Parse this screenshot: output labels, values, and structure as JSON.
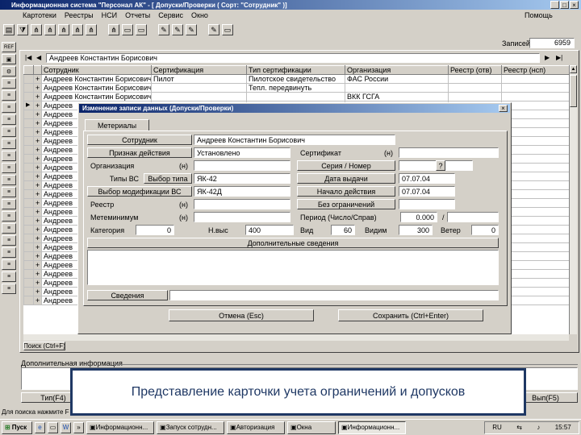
{
  "window": {
    "title": "Информационная система \"Персонал АК\" - [ Допуски/Проверки ( Сорт: \"Сотрудник\" )]"
  },
  "menubar": {
    "items": [
      "Картотеки",
      "Реестры",
      "НСИ",
      "Отчеты",
      "Сервис",
      "Окно"
    ],
    "right": "Помощь"
  },
  "records": {
    "label": "Записей",
    "count": "6959"
  },
  "filter": {
    "value": "Андреев Константин Борисович"
  },
  "table": {
    "columns": [
      "Сотрудник",
      "Сертификация",
      "Тип сертификации",
      "Организация",
      "Реестр (отв)",
      "Реестр (нсп)"
    ],
    "rows": [
      [
        "+",
        "Андреев Константин Борисович",
        "Пилот",
        "Пилотское свидетельство",
        "ФАС России",
        ""
      ],
      [
        "+",
        "Андреев Константин Борисович",
        "",
        "Тепл. передвинуть",
        "",
        ""
      ],
      [
        "+",
        "Андреев Константин Борисович",
        "",
        "",
        "ВКК ГСГА",
        ""
      ],
      [
        "▶",
        "Андреев",
        "",
        "",
        "",
        ""
      ],
      [
        "+",
        "Андреев",
        "",
        "",
        "",
        ""
      ],
      [
        "+",
        "Андреев",
        "",
        "",
        "",
        ""
      ],
      [
        "+",
        "Андреев",
        "",
        "",
        "",
        ""
      ],
      [
        "+",
        "Андреев",
        "",
        "",
        "",
        ""
      ],
      [
        "+",
        "Андреев",
        "",
        "",
        "",
        ""
      ],
      [
        "+",
        "Андреев",
        "",
        "",
        "",
        ""
      ],
      [
        "+",
        "Андреев",
        "",
        "",
        "",
        ""
      ],
      [
        "+",
        "Андреев",
        "",
        "",
        "",
        ""
      ],
      [
        "+",
        "Андреев",
        "",
        "",
        "",
        ""
      ],
      [
        "+",
        "Андреев",
        "",
        "",
        "",
        ""
      ],
      [
        "+",
        "Андреев",
        "",
        "",
        "",
        ""
      ],
      [
        "+",
        "Андреев",
        "",
        "",
        "",
        ""
      ],
      [
        "+",
        "Андреев",
        "",
        "",
        "",
        ""
      ],
      [
        "+",
        "Андреев",
        "",
        "",
        "",
        ""
      ],
      [
        "+",
        "Андреев",
        "",
        "",
        "",
        ""
      ],
      [
        "+",
        "Андреев",
        "",
        "",
        "",
        ""
      ],
      [
        "+",
        "Андреев",
        "",
        "",
        "",
        ""
      ],
      [
        "+",
        "Андреев",
        "",
        "",
        "",
        ""
      ],
      [
        "+",
        "Андреев",
        "",
        "",
        "",
        ""
      ],
      [
        "+",
        "Андреев",
        "",
        "",
        "",
        ""
      ],
      [
        "+",
        "Андреев",
        "",
        "",
        "",
        ""
      ],
      [
        "+",
        "Андреев",
        "",
        "",
        "",
        ""
      ]
    ]
  },
  "search_label": "Поиск (Ctrl+F)",
  "info_label": "Дополнительная информация",
  "bottom_left_button": "Тип(F4)",
  "bottom_right_button": "Вып(F5)",
  "hint_text": "Для поиска нажмите F",
  "dialog": {
    "title": "Изменение записи данных  (Допуски/Проверки)",
    "tab": "Метериалы",
    "employee": {
      "label": "Сотрудник",
      "value": "Андреев Константин Борисович"
    },
    "action": {
      "label": "Признак действия",
      "value": "Установлено"
    },
    "certificate": {
      "label": "Сертификат",
      "suffix": "(н)"
    },
    "organization": {
      "label": "Организация",
      "suffix": "(н)"
    },
    "series": {
      "label": "Серия / Номер",
      "button": "?"
    },
    "bs_type": {
      "label": "Типы ВС",
      "button": "Выбор типа",
      "value": "ЯК-42"
    },
    "issue_date": {
      "label": "Дата выдачи",
      "value": "07.07.04"
    },
    "bs_mod": {
      "label": "Выбор модификации ВС",
      "value": "ЯК-42Д"
    },
    "check_start": {
      "label": "Начало действия",
      "value": "07.07.04"
    },
    "registry": {
      "label": "Реестр",
      "suffix": "(н)"
    },
    "valid_until": {
      "label": "Без ограничений"
    },
    "materials": {
      "label": "Метеминимум",
      "suffix": "(н)"
    },
    "period": {
      "label": "Период (Число/Справ)",
      "value": "0.000",
      "extra": "/"
    },
    "category": {
      "label": "Категория",
      "value": "0"
    },
    "height": {
      "label": "Н.выс",
      "value": "400"
    },
    "vid": {
      "label": "Вид",
      "value": "60"
    },
    "vidim": {
      "label": "Видим",
      "value": "300"
    },
    "vetr": {
      "label": "Ветер",
      "value": "0"
    },
    "extra_header": "Дополнительные сведения",
    "note_label": "Сведения",
    "cancel_button": "Отмена (Esc)",
    "save_button": "Сохранить (Ctrl+Enter)"
  },
  "caption": {
    "text": "Представление карточки учета ограничений и допусков"
  },
  "taskbar": {
    "start": "Пуск",
    "tasks": [
      "Информационн...",
      "Запуск сотрудн...",
      "Авторизация",
      "Окна",
      "Информационн..."
    ],
    "lang": "RU",
    "time": "15:57"
  },
  "side_icons": [
    "ref-icon",
    "ref-icon",
    "tool-icon",
    "doc-icon",
    "doc-icon",
    "doc-icon",
    "doc-icon",
    "doc-icon",
    "doc-icon",
    "doc-icon",
    "doc-icon",
    "doc-icon",
    "doc-icon",
    "doc-icon",
    "doc-icon",
    "doc-icon",
    "doc-icon",
    "doc-icon",
    "doc-icon",
    "doc-icon",
    "doc-icon"
  ]
}
